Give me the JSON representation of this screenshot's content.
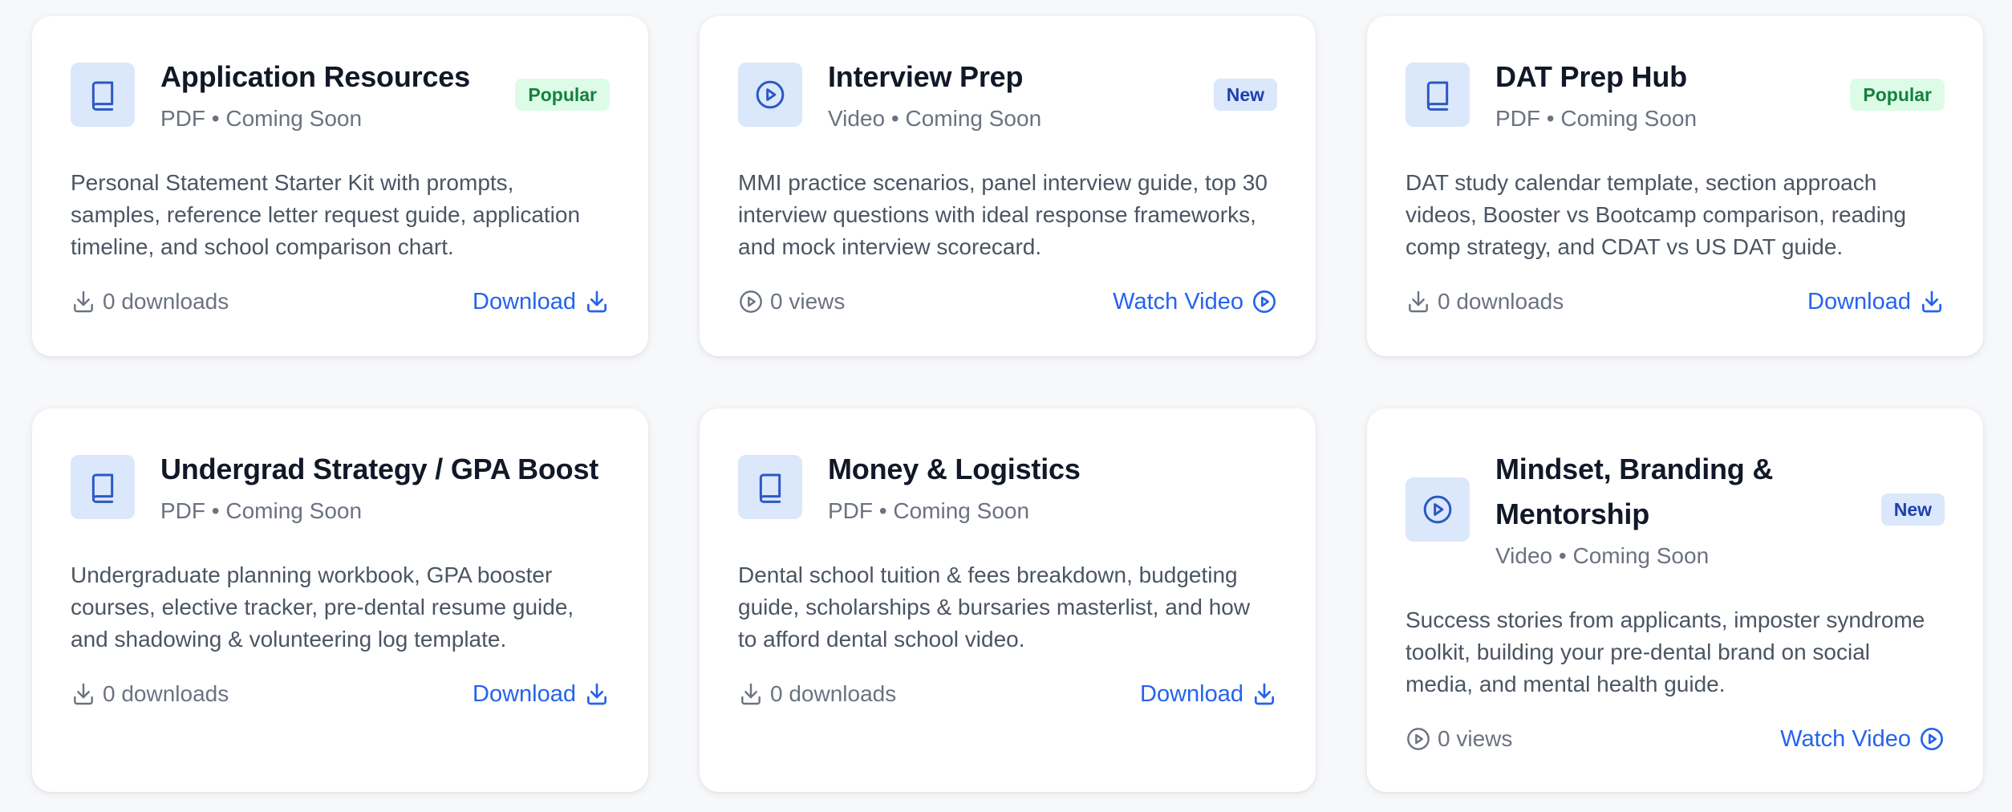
{
  "colors": {
    "accent": "#2563eb",
    "icon_bg": "#dbe7fb",
    "popular_bg": "#dcfce7",
    "popular_text": "#15803d",
    "new_bg": "#dbe7fb",
    "new_text": "#1e40af"
  },
  "cards": [
    {
      "icon": "book-icon",
      "title": "Application Resources",
      "format": "PDF",
      "status": "Coming Soon",
      "badge": "Popular",
      "description": "Personal Statement Starter Kit with prompts, samples, reference letter request guide, application timeline, and school comparison chart.",
      "stat": "0 downloads",
      "action": "Download"
    },
    {
      "icon": "play-circle-icon",
      "title": "Interview Prep",
      "format": "Video",
      "status": "Coming Soon",
      "badge": "New",
      "description": "MMI practice scenarios, panel interview guide, top 30 interview questions with ideal response frameworks, and mock interview scorecard.",
      "stat": "0 views",
      "action": "Watch Video"
    },
    {
      "icon": "book-icon",
      "title": "DAT Prep Hub",
      "format": "PDF",
      "status": "Coming Soon",
      "badge": "Popular",
      "description": "DAT study calendar template, section approach videos, Booster vs Bootcamp comparison, reading comp strategy, and CDAT vs US DAT guide.",
      "stat": "0 downloads",
      "action": "Download"
    },
    {
      "icon": "book-icon",
      "title": "Undergrad Strategy / GPA Boost",
      "format": "PDF",
      "status": "Coming Soon",
      "badge": "",
      "description": "Undergraduate planning workbook, GPA booster courses, elective tracker, pre-dental resume guide, and shadowing & volunteering log template.",
      "stat": "0 downloads",
      "action": "Download"
    },
    {
      "icon": "book-icon",
      "title": "Money & Logistics",
      "format": "PDF",
      "status": "Coming Soon",
      "badge": "",
      "description": "Dental school tuition & fees breakdown, budgeting guide, scholarships & bursaries masterlist, and how to afford dental school video.",
      "stat": "0 downloads",
      "action": "Download"
    },
    {
      "icon": "play-circle-icon",
      "title": "Mindset, Branding & Mentorship",
      "format": "Video",
      "status": "Coming Soon",
      "badge": "New",
      "description": "Success stories from applicants, imposter syndrome toolkit, building your pre-dental brand on social media, and mental health guide.",
      "stat": "0 views",
      "action": "Watch Video"
    }
  ]
}
